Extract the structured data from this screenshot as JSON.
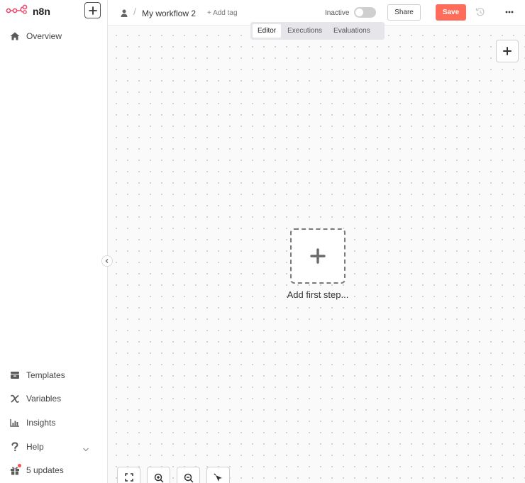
{
  "app": {
    "logo_text": "n8n",
    "accent_color": "#ff6d5a",
    "logo_color": "#ea4b71"
  },
  "sidebar": {
    "top_items": [
      {
        "label": "Overview",
        "icon": "home-icon"
      }
    ],
    "bottom_items": [
      {
        "label": "Templates",
        "icon": "templates-icon"
      },
      {
        "label": "Variables",
        "icon": "variables-icon"
      },
      {
        "label": "Insights",
        "icon": "chart-icon"
      },
      {
        "label": "Help",
        "icon": "question-icon"
      },
      {
        "label": "5 updates",
        "icon": "gift-icon"
      }
    ]
  },
  "header": {
    "workflow_name": "My workflow 2",
    "add_tag_label": "+ Add tag",
    "status_label": "Inactive",
    "active": false,
    "share_label": "Share",
    "save_label": "Save"
  },
  "tabs": [
    {
      "label": "Editor",
      "active": true
    },
    {
      "label": "Executions",
      "active": false
    },
    {
      "label": "Evaluations",
      "active": false
    }
  ],
  "canvas": {
    "add_first_step_label": "Add first step..."
  }
}
